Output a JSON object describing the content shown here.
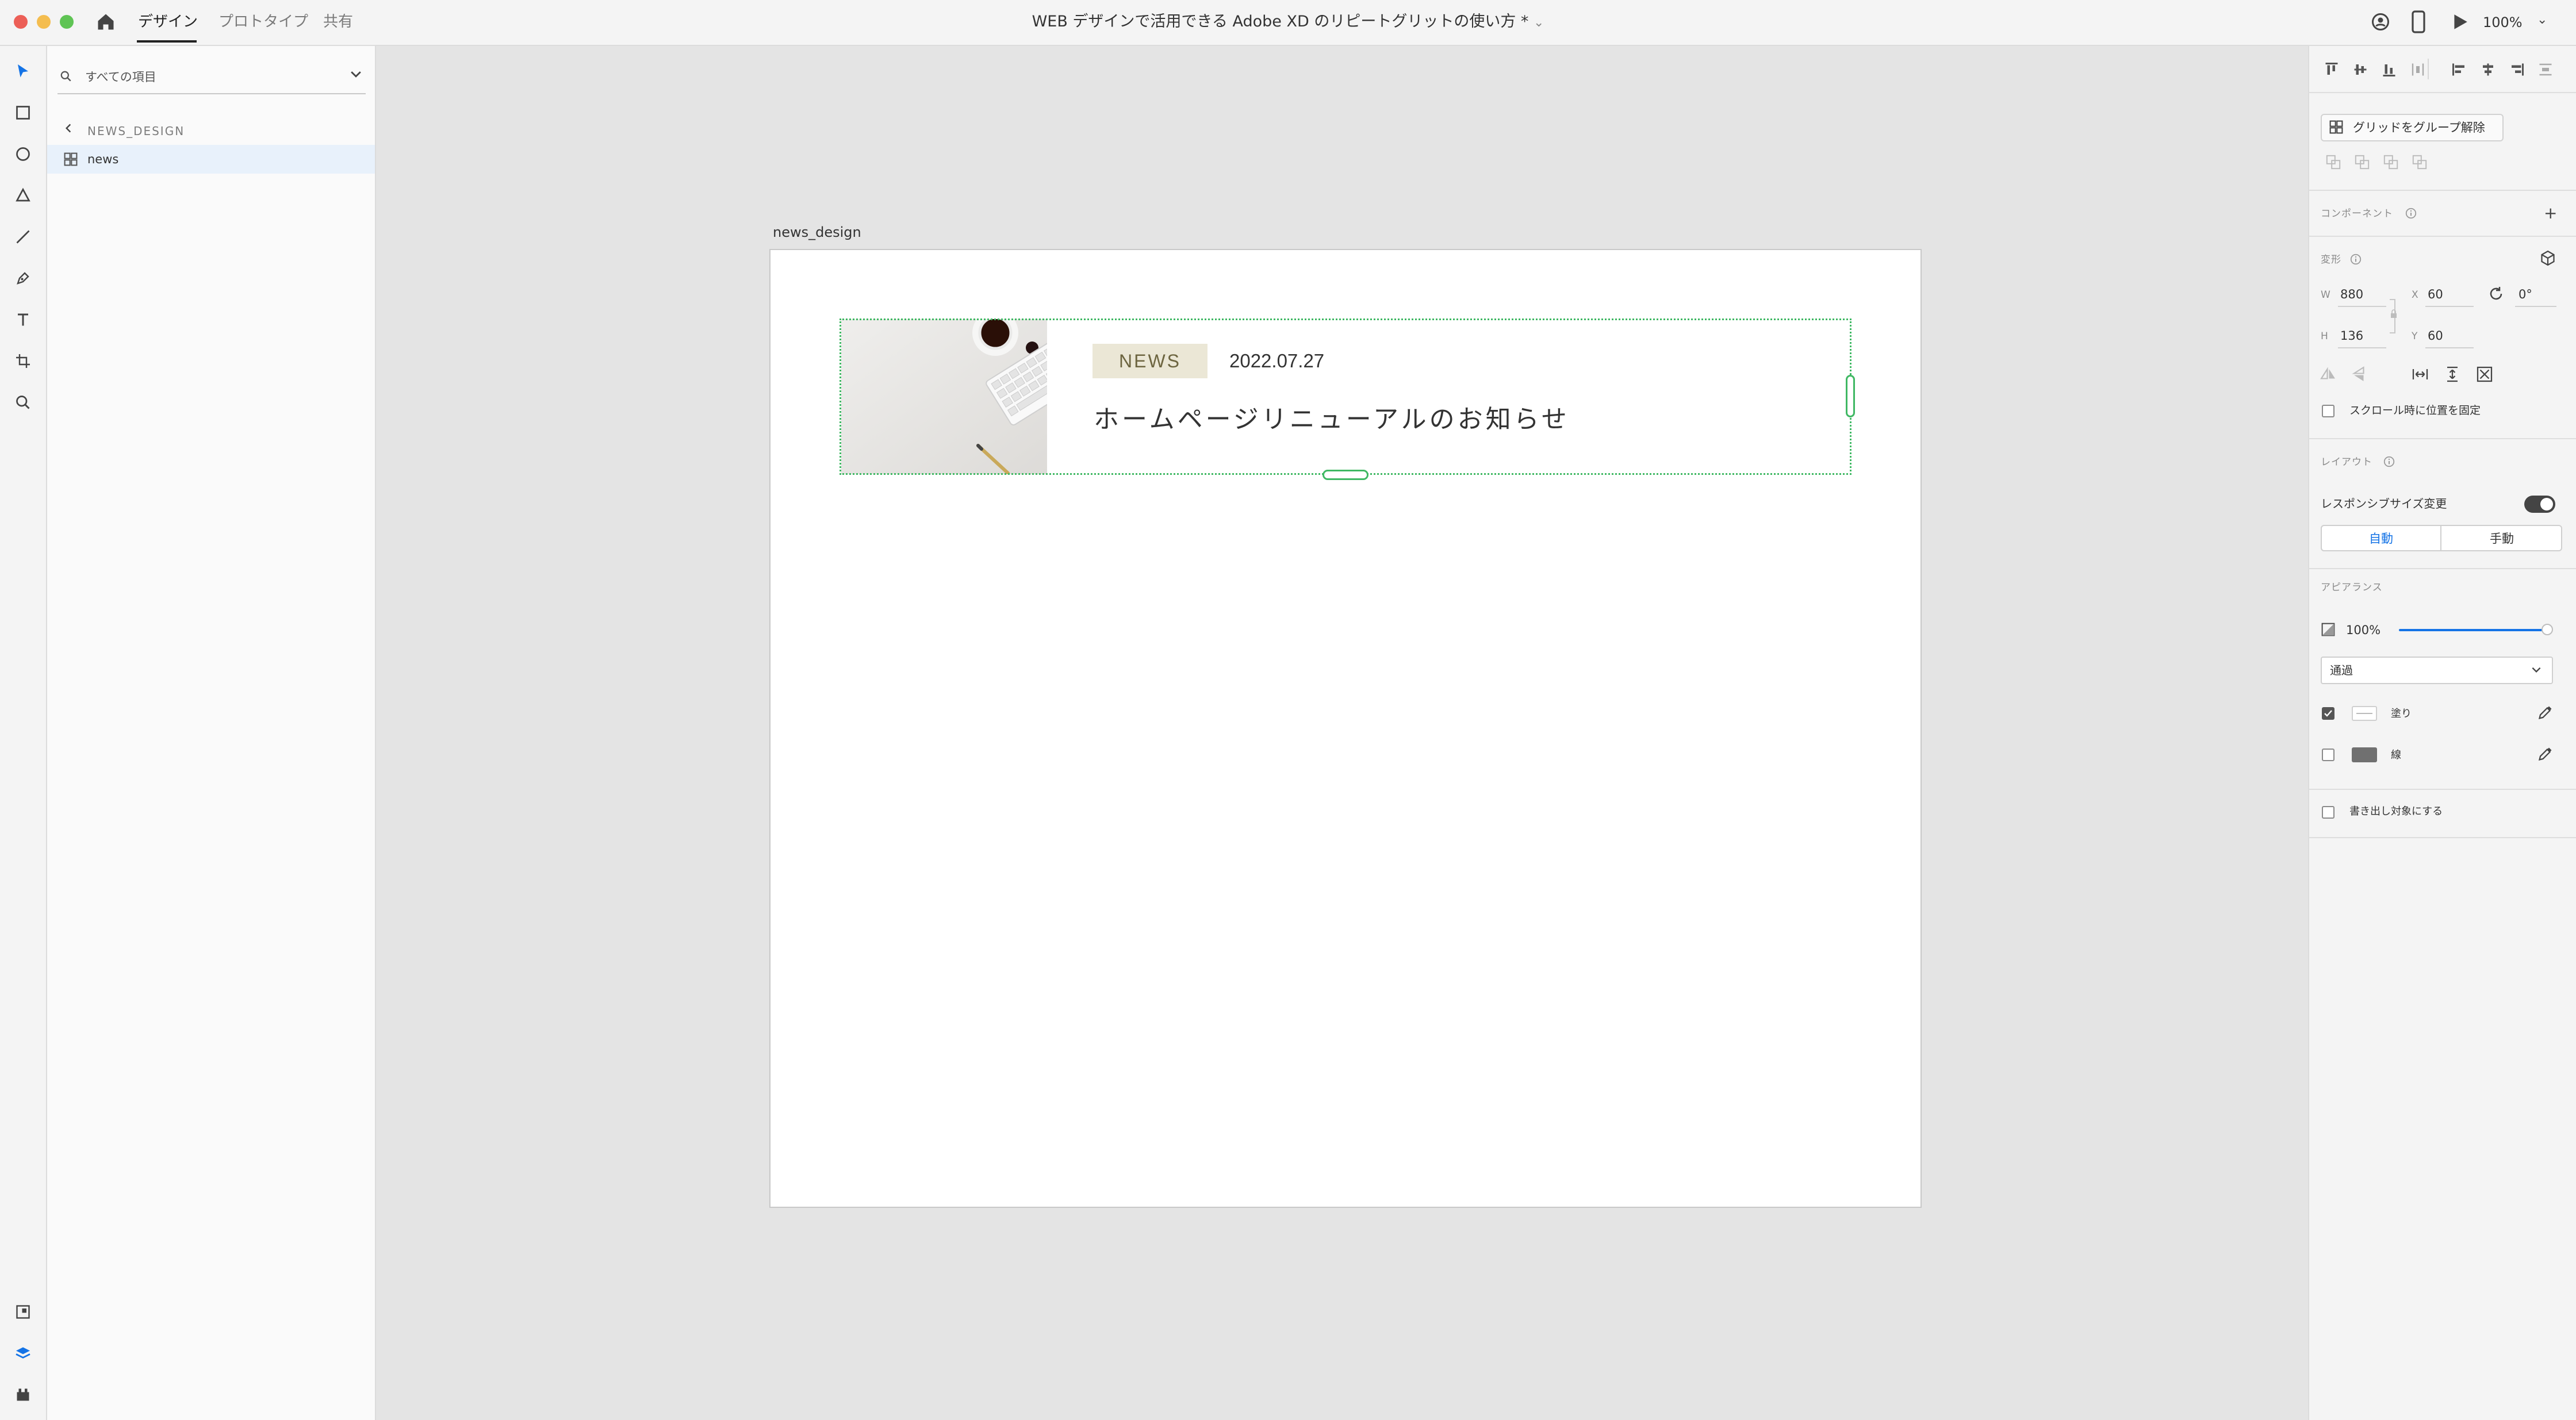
{
  "titlebar": {
    "tabs": [
      "デザイン",
      "プロトタイプ",
      "共有"
    ],
    "active_tab": "デザイン",
    "document_title": "WEB デザインで活用できる Adobe XD のリピートグリットの使い方 *",
    "zoom": "100%"
  },
  "toolbar": {
    "tools": [
      "select-icon",
      "rectangle-icon",
      "ellipse-icon",
      "polygon-icon",
      "line-icon",
      "pen-icon",
      "text-icon",
      "artboard-icon",
      "zoom-icon"
    ],
    "bottom_tools": [
      "assets-icon",
      "layers-icon",
      "plugins-icon"
    ]
  },
  "layers": {
    "search_placeholder": "すべての項目",
    "breadcrumb": "NEWS_DESIGN",
    "items": [
      {
        "name": "news",
        "icon": "repeat-grid-icon",
        "selected": true
      }
    ]
  },
  "canvas": {
    "artboard_name": "news_design",
    "news_item": {
      "badge": "NEWS",
      "date": "2022.07.27",
      "title": "ホームページリニューアルのお知らせ"
    },
    "selection_color": "#3fb863"
  },
  "inspector": {
    "ungroup_grid_label": "グリッドをグループ解除",
    "component_label": "コンポーネント",
    "transform_label": "変形",
    "w_label": "W",
    "w_value": "880",
    "h_label": "H",
    "h_value": "136",
    "x_label": "X",
    "x_value": "60",
    "y_label": "Y",
    "y_value": "60",
    "rotation_value": "0°",
    "fix_on_scroll_label": "スクロール時に位置を固定",
    "layout_label": "レイアウト",
    "responsive_label": "レスポンシブサイズ変更",
    "responsive_on": true,
    "mode_auto": "自動",
    "mode_manual": "手動",
    "appearance_label": "アピアランス",
    "opacity": "100%",
    "opacity_fraction": 1.0,
    "blend_mode": "通過",
    "fill_label": "塗り",
    "fill_checked": true,
    "stroke_label": "線",
    "stroke_checked": false,
    "export_label": "書き出し対象にする",
    "accent_color": "#1473e6"
  }
}
